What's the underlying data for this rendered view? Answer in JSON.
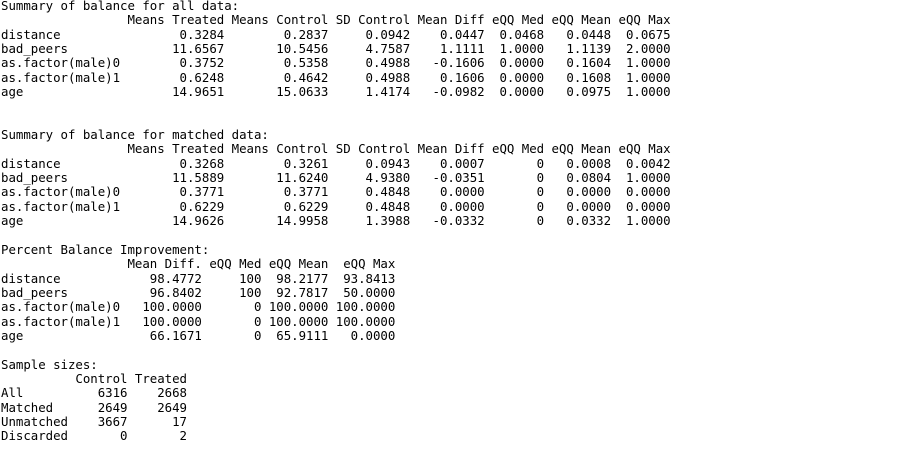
{
  "console": {
    "lines": [
      "Summary of balance for all data:",
      "                 Means Treated Means Control SD Control Mean Diff eQQ Med eQQ Mean eQQ Max",
      "distance                0.3284        0.2837     0.0942    0.0447  0.0468   0.0448  0.0675",
      "bad_peers              11.6567       10.5456     4.7587    1.1111  1.0000   1.1139  2.0000",
      "as.factor(male)0        0.3752        0.5358     0.4988   -0.1606  0.0000   0.1604  1.0000",
      "as.factor(male)1        0.6248        0.4642     0.4988    0.1606  0.0000   0.1608  1.0000",
      "age                    14.9651       15.0633     1.4174   -0.0982  0.0000   0.0975  1.0000",
      "",
      "",
      "Summary of balance for matched data:",
      "                 Means Treated Means Control SD Control Mean Diff eQQ Med eQQ Mean eQQ Max",
      "distance                0.3268        0.3261     0.0943    0.0007       0   0.0008  0.0042",
      "bad_peers              11.5889       11.6240     4.9380   -0.0351       0   0.0804  1.0000",
      "as.factor(male)0        0.3771        0.3771     0.4848    0.0000       0   0.0000  0.0000",
      "as.factor(male)1        0.6229        0.6229     0.4848    0.0000       0   0.0000  0.0000",
      "age                    14.9626       14.9958     1.3988   -0.0332       0   0.0332  1.0000",
      "",
      "Percent Balance Improvement:",
      "                 Mean Diff. eQQ Med eQQ Mean  eQQ Max",
      "distance            98.4772     100  98.2177  93.8413",
      "bad_peers           96.8402     100  92.7817  50.0000",
      "as.factor(male)0   100.0000       0 100.0000 100.0000",
      "as.factor(male)1   100.0000       0 100.0000 100.0000",
      "age                 66.1671       0  65.9111   0.0000",
      "",
      "Sample sizes:",
      "          Control Treated",
      "All          6316    2668",
      "Matched      2649    2649",
      "Unmatched    3667      17",
      "Discarded       0       2"
    ]
  }
}
